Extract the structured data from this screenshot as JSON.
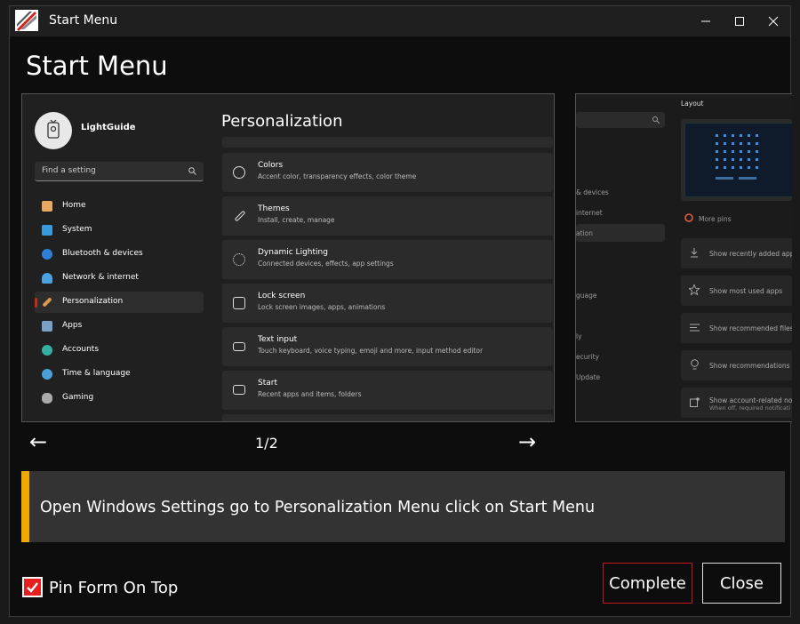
{
  "window": {
    "title": "Start Menu"
  },
  "page": {
    "title": "Start Menu"
  },
  "screenshot": {
    "account_name": "LightGuide",
    "search_placeholder": "Find a setting",
    "nav": [
      {
        "label": "Home",
        "color": "#e8a860"
      },
      {
        "label": "System",
        "color": "#3a9ad9"
      },
      {
        "label": "Bluetooth & devices",
        "color": "#2f7fd6"
      },
      {
        "label": "Network & internet",
        "color": "#4aa3df"
      },
      {
        "label": "Personalization",
        "color": "#d99a50"
      },
      {
        "label": "Apps",
        "color": "#7aa0c8"
      },
      {
        "label": "Accounts",
        "color": "#33b0a0"
      },
      {
        "label": "Time & language",
        "color": "#4aa0d8"
      },
      {
        "label": "Gaming",
        "color": "#aaaaaa"
      }
    ],
    "pane_title": "Personalization",
    "cards": [
      {
        "title": "Colors",
        "sub": "Accent color, transparency effects, color theme"
      },
      {
        "title": "Themes",
        "sub": "Install, create, manage"
      },
      {
        "title": "Dynamic Lighting",
        "sub": "Connected devices, effects, app settings"
      },
      {
        "title": "Lock screen",
        "sub": "Lock screen images, apps, animations"
      },
      {
        "title": "Text input",
        "sub": "Touch keyboard, voice typing, emoji and more, input method editor"
      },
      {
        "title": "Start",
        "sub": "Recent apps and items, folders"
      }
    ]
  },
  "next_screenshot": {
    "layout_label": "Layout",
    "more_pins": "More pins",
    "left_items": [
      "& devices",
      "internet",
      "ation",
      "guage",
      "ly",
      "ecurity",
      "Update"
    ],
    "rows": [
      "Show recently added apps",
      "Show most used apps",
      "Show recommended files",
      "Show recommendations f",
      "Show account-related no"
    ],
    "row_sub": "When off, required notificati"
  },
  "carousel": {
    "pager": "1/2",
    "prev": "←",
    "next": "→"
  },
  "instruction": {
    "text": "Open Windows Settings go to Personalization Menu click on Start Menu",
    "accent": "#f0a800"
  },
  "footer": {
    "pin_label": "Pin Form On Top",
    "pin_checked": true,
    "complete_label": "Complete",
    "close_label": "Close"
  }
}
